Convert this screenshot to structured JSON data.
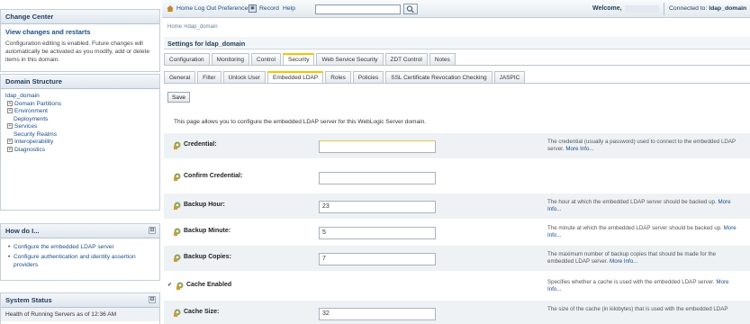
{
  "change_center": {
    "title": "Change Center",
    "view_link": "View changes and restarts",
    "text": "Configuration editing is enabled. Future changes will automatically be activated as you modify, add or delete items in this domain."
  },
  "domain_structure": {
    "title": "Domain Structure",
    "items": [
      {
        "label": "ldap_domain",
        "prefix": ""
      },
      {
        "label": "Domain Partitions",
        "prefix": "+"
      },
      {
        "label": "Environment",
        "prefix": "+"
      },
      {
        "label": "Deployments",
        "prefix": "-"
      },
      {
        "label": "Services",
        "prefix": "+"
      },
      {
        "label": "Security Realms",
        "prefix": "-"
      },
      {
        "label": "Interoperability",
        "prefix": "+"
      },
      {
        "label": "Diagnostics",
        "prefix": "+"
      }
    ]
  },
  "how_do_i": {
    "title": "How do I...",
    "items": [
      "Configure the embedded LDAP server",
      "Configure authentication and identity assertion providers"
    ]
  },
  "system_status": {
    "title": "System Status",
    "text": "Health of Running Servers as of  12:36 AM"
  },
  "topbar": {
    "home": "Home",
    "logout": "Log Out",
    "preferences": "Preferences",
    "record": "Record",
    "help": "Help",
    "welcome": "Welcome,",
    "connected_prefix": "Connected to:",
    "domain": "ldap_domain"
  },
  "breadcrumb": "Home >ldap_domain",
  "settings_title": "Settings for ldap_domain",
  "tabs_primary": [
    {
      "label": "Configuration",
      "active": false
    },
    {
      "label": "Monitoring",
      "active": false
    },
    {
      "label": "Control",
      "active": false
    },
    {
      "label": "Security",
      "active": true
    },
    {
      "label": "Web Service Security",
      "active": false
    },
    {
      "label": "ZDT Control",
      "active": false
    },
    {
      "label": "Notes",
      "active": false
    }
  ],
  "tabs_secondary": [
    {
      "label": "General",
      "active": false
    },
    {
      "label": "Filter",
      "active": false
    },
    {
      "label": "Unlock User",
      "active": false
    },
    {
      "label": "Embedded LDAP",
      "active": true
    },
    {
      "label": "Roles",
      "active": false
    },
    {
      "label": "Policies",
      "active": false
    },
    {
      "label": "SSL Certificate Revocation Checking",
      "active": false
    },
    {
      "label": "JASPIC",
      "active": false
    }
  ],
  "save_label": "Save",
  "description": "This page allows you to configure the embedded LDAP server for this WebLogic Server domain.",
  "fields": [
    {
      "label": "Credential:",
      "value": "",
      "help": "The credential (usually a password) used to connect to the embedded LDAP server.",
      "more": "More Info..."
    },
    {
      "label": "Confirm Credential:",
      "value": "",
      "help": "",
      "more": ""
    },
    {
      "label": "Backup Hour:",
      "value": "23",
      "help": "The hour at which the embedded LDAP server should be backed up.",
      "more": "More Info..."
    },
    {
      "label": "Backup Minute:",
      "value": "5",
      "help": "The minute at which the embedded LDAP server should be backed up.",
      "more": "More Info..."
    },
    {
      "label": "Backup Copies:",
      "value": "7",
      "help": "The maximum number of backup copies that should be made for the embedded LDAP server.",
      "more": "More Info..."
    },
    {
      "label": "Cache Enabled",
      "value": "",
      "checked": true,
      "help": "Specifies whether a cache is used with the embedded LDAP server.",
      "more": "More Info..."
    },
    {
      "label": "Cache Size:",
      "value": "32",
      "help": "The size of the cache (in kilobytes) that is used with the embedded LDAP",
      "more": ""
    }
  ]
}
